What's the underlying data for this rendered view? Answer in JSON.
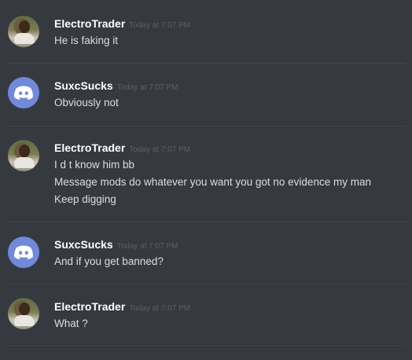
{
  "messages": [
    {
      "author": "ElectroTrader",
      "avatar": "profile-photo",
      "timestamp": "Today at 7:07 PM",
      "lines": [
        "He is faking it"
      ]
    },
    {
      "author": "SuxcSucks",
      "avatar": "discord-default-icon",
      "timestamp": "Today at 7:07 PM",
      "lines": [
        "Obviously not"
      ]
    },
    {
      "author": "ElectroTrader",
      "avatar": "profile-photo",
      "timestamp": "Today at 7:07 PM",
      "lines": [
        "I d t know him bb",
        "Message mods do whatever you want you got no evidence my man",
        "Keep digging"
      ]
    },
    {
      "author": "SuxcSucks",
      "avatar": "discord-default-icon",
      "timestamp": "Today at 7:07 PM",
      "lines": [
        "And if you get banned?"
      ]
    },
    {
      "author": "ElectroTrader",
      "avatar": "profile-photo",
      "timestamp": "Today at 7:07 PM",
      "lines": [
        "What ?"
      ]
    }
  ],
  "colors": {
    "background": "#36393f",
    "author": "#ffffff",
    "message_text": "#dcddde",
    "timestamp": "#5c5f64",
    "discord_blurple": "#7289da"
  }
}
